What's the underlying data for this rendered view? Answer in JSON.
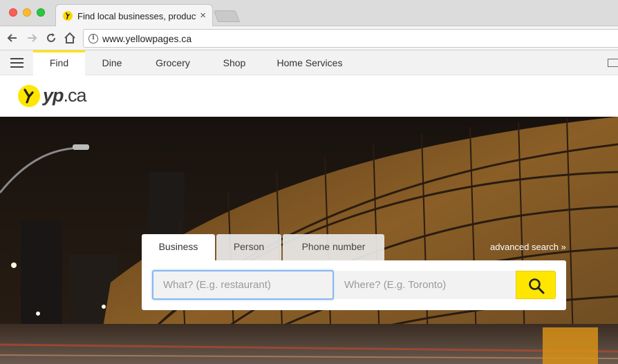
{
  "browser": {
    "tab_title": "Find local businesses, products",
    "tab_close": "×",
    "url": "www.yellowpages.ca"
  },
  "sitenav": {
    "items": [
      {
        "label": "Find"
      },
      {
        "label": "Dine"
      },
      {
        "label": "Grocery"
      },
      {
        "label": "Shop"
      },
      {
        "label": "Home Services"
      }
    ],
    "active": "Find"
  },
  "logo": {
    "text": "yp",
    "suffix": ".ca"
  },
  "search": {
    "tabs": [
      {
        "label": "Business"
      },
      {
        "label": "Person"
      },
      {
        "label": "Phone number"
      }
    ],
    "advanced_label": "advanced search »",
    "what_placeholder": "What? (E.g. restaurant)",
    "where_placeholder": "Where? (E.g. Toronto)"
  },
  "colors": {
    "brand_yellow": "#ffe600",
    "focus_blue": "#87b7ef"
  }
}
